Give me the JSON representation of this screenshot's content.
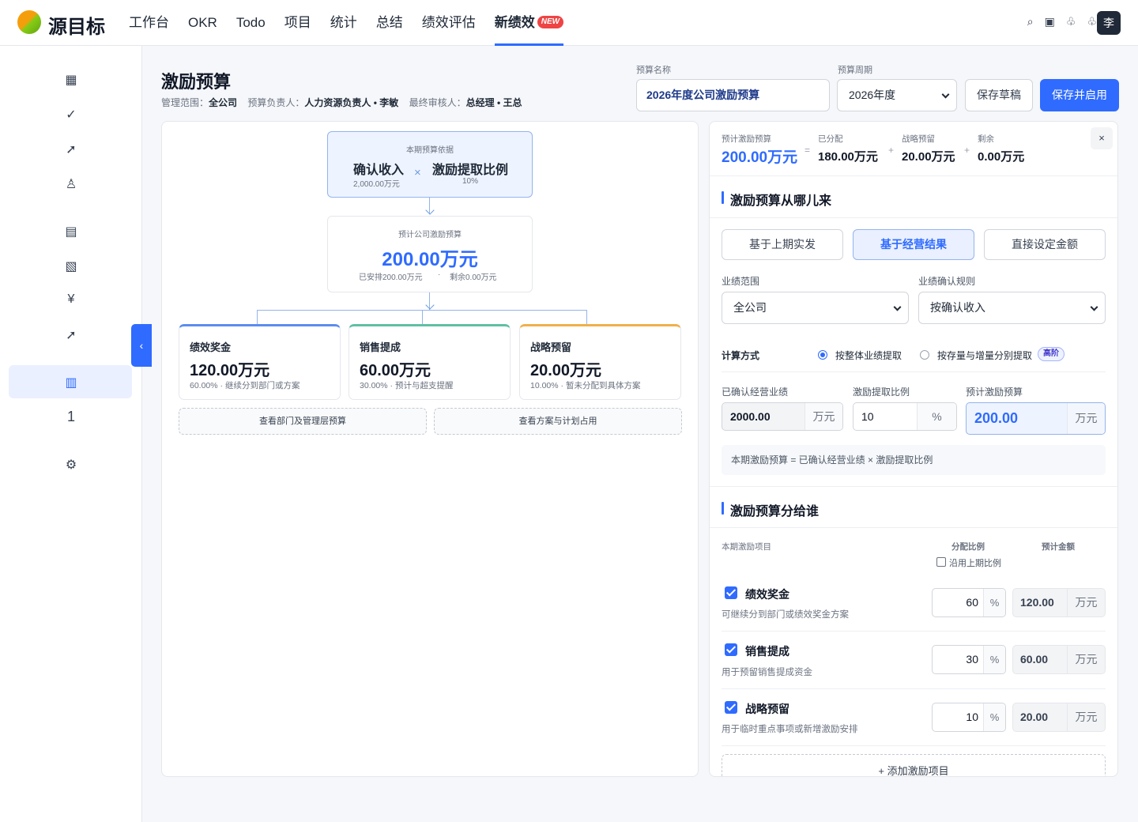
{
  "app": {
    "name": "源目标",
    "avatar": "李"
  },
  "nav": {
    "items": [
      "工作台",
      "OKR",
      "Todo",
      "项目",
      "统计",
      "总结",
      "绩效评估"
    ],
    "active": "新绩效",
    "new_badge": "NEW"
  },
  "top_icons": [
    "search-icon",
    "layout-icon",
    "bell-icon",
    "notification-icon"
  ],
  "sidebar": {
    "icons": [
      "grid-icon",
      "check-icon",
      "trend-icon",
      "person-icon",
      "list-icon",
      "report-icon",
      "yen-icon",
      "growth-icon",
      "budget-icon",
      "one-icon",
      "settings-icon"
    ],
    "glyphs": [
      "▦",
      "✓",
      "➚",
      "♙",
      "▤",
      "▧",
      "¥",
      "➚",
      "▥",
      "1",
      "⚙"
    ],
    "collapse": "‹"
  },
  "page": {
    "title": "激励预算",
    "scope_label": "管理范围：",
    "scope": "全公司",
    "owner_label": "预算负责人：",
    "owner": "人力资源负责人 • 李敏",
    "approver_label": "最终审核人：",
    "approver": "总经理 • 王总"
  },
  "form": {
    "name_label": "预算名称",
    "name_value": "2026年度公司激励预算",
    "period_label": "预算周期",
    "period_value": "2026年度",
    "save_draft": "保存草稿",
    "save_enable": "保存并启用"
  },
  "flow": {
    "basis_title": "本期预算依据",
    "income_label": "确认收入",
    "income_value": "2,000.00万元",
    "times": "×",
    "ratio_label": "激励提取比例",
    "ratio_value": "10%",
    "total_title": "预计公司激励预算",
    "total_value": "200.00万元",
    "allocated": "已安排200.00万元",
    "dot": "·",
    "remaining": "剩余0.00万元",
    "allocations": [
      {
        "name": "绩效奖金",
        "value": "120.00万元",
        "desc": "60.00% · 继续分到部门或方案",
        "color": "#5b8def"
      },
      {
        "name": "销售提成",
        "value": "60.00万元",
        "desc": "30.00% · 预计与超支提醒",
        "color": "#5fc0a3"
      },
      {
        "name": "战略预留",
        "value": "20.00万元",
        "desc": "10.00% · 暂未分配到具体方案",
        "color": "#f0b04a"
      }
    ],
    "btn_dept": "查看部门及管理层预算",
    "btn_plan": "查看方案与计划占用"
  },
  "summary": {
    "total_label": "预计激励预算",
    "total": "200.00万元",
    "allocated_label": "已分配",
    "allocated": "180.00万元",
    "reserve_label": "战略预留",
    "reserve": "20.00万元",
    "remain_label": "剩余",
    "remain": "0.00万元",
    "eq": "=",
    "plus": "+",
    "close": "×"
  },
  "source": {
    "title": "激励预算从哪儿来",
    "options": [
      "基于上期实发",
      "基于经营结果",
      "直接设定金额"
    ],
    "active_option": 1,
    "scope_label": "业绩范围",
    "scope_value": "全公司",
    "rule_label": "业绩确认规则",
    "rule_value": "按确认收入",
    "calc_label": "计算方式",
    "calc_opt1": "按整体业绩提取",
    "calc_opt2": "按存量与增量分别提取",
    "adv_badge": "高阶",
    "perf_label": "已确认经营业绩",
    "perf_value": "2000.00",
    "ratio_label": "激励提取比例",
    "ratio_value": "10",
    "est_label": "预计激励预算",
    "est_value": "200.00",
    "unit_wan": "万元",
    "unit_pct": "%",
    "formula": "本期激励预算 = 已确认经营业绩 × 激励提取比例"
  },
  "distribution": {
    "title": "激励预算分给谁",
    "col_item": "本期激励项目",
    "col_ratio": "分配比例",
    "col_amount": "预计金额",
    "follow_last": "沿用上期比例",
    "items": [
      {
        "name": "绩效奖金",
        "desc": "可继续分到部门或绩效奖金方案",
        "ratio": "60",
        "amount": "120.00"
      },
      {
        "name": "销售提成",
        "desc": "用于预留销售提成资金",
        "ratio": "30",
        "amount": "60.00"
      },
      {
        "name": "战略预留",
        "desc": "用于临时重点事项或新增激励安排",
        "ratio": "10",
        "amount": "20.00"
      }
    ],
    "add": "+ 添加激励项目"
  }
}
